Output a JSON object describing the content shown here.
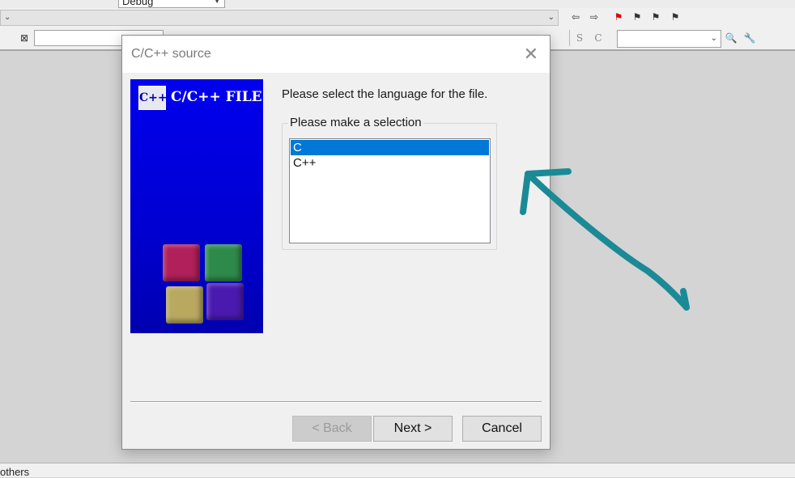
{
  "toolbar": {
    "build_target": "Debug",
    "search_placeholder": "",
    "function_combo_value": ""
  },
  "statusbar": {
    "text": "others"
  },
  "dialog": {
    "title": "C/C++ source",
    "close_glyph": "✕",
    "banner": {
      "logo_text": "C++",
      "label": "C/C++ FILE",
      "background_color": "#0000ee"
    },
    "prompt": "Please select the language for the file.",
    "group_label": "Please make a selection",
    "languages": [
      "C",
      "C++"
    ],
    "selected_language": "C",
    "buttons": {
      "back": "< Back",
      "next": "Next >",
      "cancel": "Cancel"
    }
  },
  "annotation": {
    "arrow_color": "#1b8a96"
  }
}
